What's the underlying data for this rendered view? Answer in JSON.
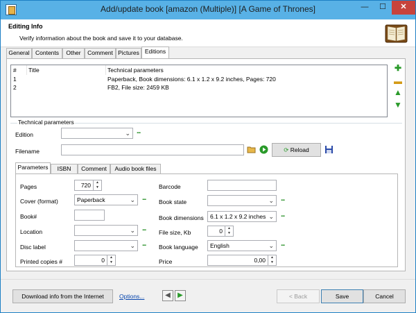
{
  "window": {
    "title": "Add/update book [amazon (Multiple)] [A Game of Thrones]",
    "minimize_glyph": "—",
    "maximize_glyph": "☐",
    "close_glyph": "✕"
  },
  "header": {
    "title": "Editing Info",
    "subtitle": "Verify information about the book and save it to your database."
  },
  "main_tabs": [
    "General",
    "Contents",
    "Other",
    "Comment",
    "Pictures",
    "Editions"
  ],
  "main_tabs_active": "Editions",
  "editions_list": {
    "columns": [
      "#",
      "Title",
      "Technical parameters"
    ],
    "rows": [
      {
        "num": "1",
        "title": "",
        "params": "Paperback, Book dimensions: 6.1 x 1.2 x 9.2 inches, Pages: 720"
      },
      {
        "num": "2",
        "title": "",
        "params": "FB2, File size: 2459 KB"
      }
    ]
  },
  "side_icons": [
    "add-icon",
    "remove-icon",
    "move-up-icon",
    "move-down-icon"
  ],
  "technical": {
    "group_label": "Technical parameters",
    "edition_label": "Edition",
    "edition_value": "",
    "filename_label": "Filename",
    "filename_value": "",
    "reload_label": "Reload"
  },
  "sub_tabs": [
    "Parameters",
    "ISBN",
    "Comment",
    "Audio book files"
  ],
  "sub_tabs_active": "Parameters",
  "parameters": {
    "pages_label": "Pages",
    "pages_value": "720",
    "cover_label": "Cover (format)",
    "cover_value": "Paperback",
    "booknum_label": "Book#",
    "booknum_value": "",
    "location_label": "Location",
    "location_value": "",
    "disc_label": "Disc label",
    "disc_value": "",
    "printed_copies_label": "Printed copies #",
    "printed_copies_value": "0",
    "barcode_label": "Barcode",
    "barcode_value": "",
    "book_state_label": "Book state",
    "book_state_value": "",
    "book_dims_label": "Book dimensions",
    "book_dims_value": "6.1 x 1.2 x 9.2 inches",
    "file_size_label": "File size, Kb",
    "file_size_value": "0",
    "book_language_label": "Book language",
    "book_language_value": "English",
    "price_label": "Price",
    "price_value": "0,00"
  },
  "bottom": {
    "download_label": "Download info from the Internet",
    "options_label": "Options...",
    "back_label": "< Back",
    "save_label": "Save",
    "cancel_label": "Cancel"
  },
  "dots": "...",
  "accent": "#1c8a1c"
}
